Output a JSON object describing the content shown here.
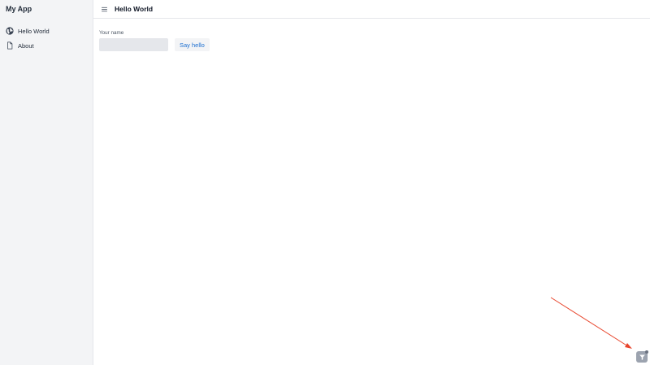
{
  "sidebar": {
    "brand": "My App",
    "items": [
      {
        "label": "Hello World",
        "icon": "globe-icon"
      },
      {
        "label": "About",
        "icon": "document-icon"
      }
    ]
  },
  "header": {
    "title": "Hello World",
    "menu_icon": "hamburger-menu-icon"
  },
  "form": {
    "name_label": "Your name",
    "name_value": "",
    "name_placeholder": "",
    "submit_label": "Say hello"
  },
  "colors": {
    "sidebar_bg": "#f3f4f6",
    "link_blue": "#1d6fd0",
    "annotation_red": "#e8452c"
  },
  "corner_widget": {
    "icon": "funnel-icon"
  }
}
